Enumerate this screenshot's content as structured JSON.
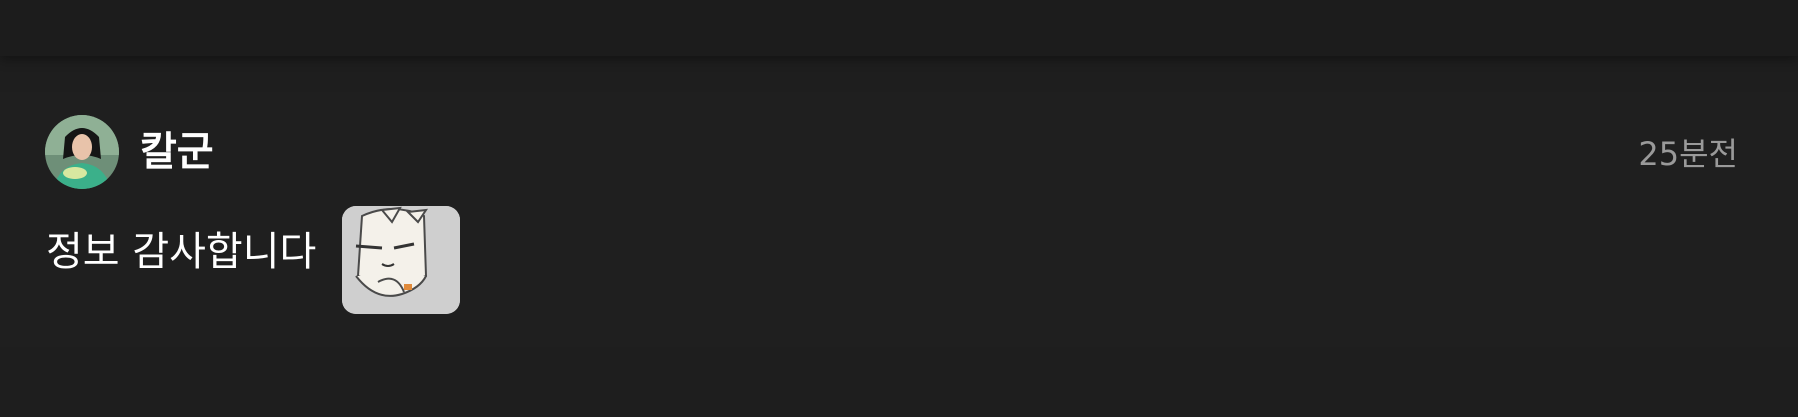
{
  "comment": {
    "author": "칼군",
    "timestamp": "25분전",
    "text": "정보 감사합니다",
    "avatar_icon": "user-avatar-photo",
    "sticker_icon": "cartoon-cat-sticker"
  },
  "colors": {
    "background": "#1e1e1e",
    "author_text": "#ffffff",
    "timestamp_text": "#9a9a9a",
    "body_text": "#ffffff"
  }
}
